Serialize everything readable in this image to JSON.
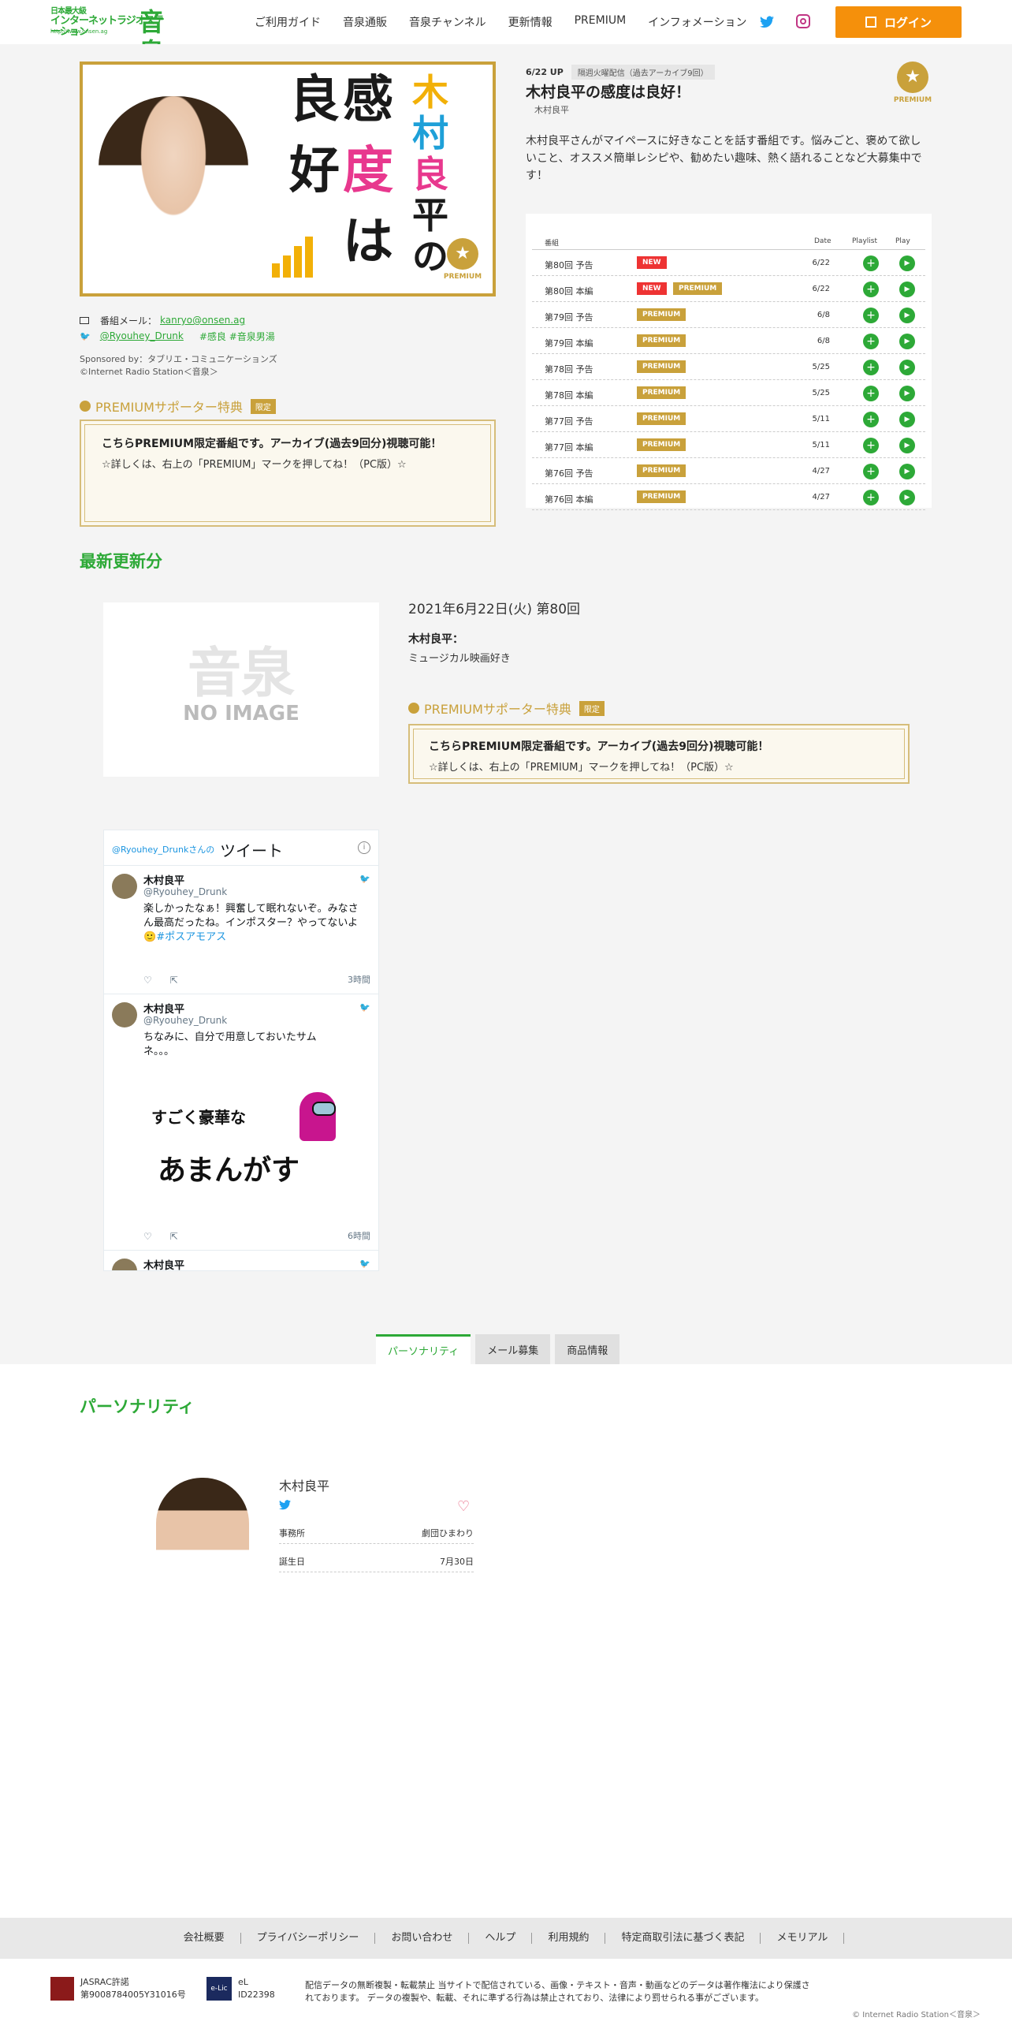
{
  "header": {
    "logo_line1": "日本最大級",
    "logo_line2": "インターネットラジオステーション",
    "logo_url": "http://www.onsen.ag",
    "logo_big": "音泉",
    "nav": [
      "ご利用ガイド",
      "音泉通販",
      "音泉チャンネル",
      "更新情報",
      "PREMIUM",
      "インフォメーション"
    ],
    "login": "ログイン"
  },
  "program": {
    "image_text": [
      "良",
      "好",
      "感",
      "度",
      "は",
      "木",
      "村",
      "良",
      "平",
      "の"
    ],
    "premium_label": "PREMIUM",
    "mail_label": "番組メール：",
    "mail": "kanryo@onsen.ag",
    "twitter": "@Ryouhey_Drunk",
    "hashtags": "#感良 #音泉男湯",
    "sponsor": "Sponsored by：タブリエ・コミュニケーションズ",
    "copyright": "©Internet Radio Station＜音泉＞",
    "premium_head": "PREMIUMサポーター特典",
    "premium_tag": "限定",
    "premium_bold": "こちらPREMIUM限定番組です。アーカイブ(過去9回分)視聴可能！",
    "premium_sub": "☆詳しくは、右上の「PREMIUM」マークを押してね！（PC版）☆",
    "up_date": "6/22 UP",
    "up_tag": "隔週火曜配信（過去アーカイブ9回）",
    "title": "木村良平の感度は良好！",
    "person": "木村良平",
    "description": "木村良平さんがマイペースに好きなことを話す番組です。悩みごと、褒めて欲しいこと、オススメ簡単レシピや、勧めたい趣味、熱く語れることなど大募集中です！"
  },
  "episode_table": {
    "headers": {
      "program": "番組",
      "date": "Date",
      "playlist": "Playlist",
      "play": "Play"
    },
    "rows": [
      {
        "title": "第80回 予告",
        "new": "NEW",
        "premium": "",
        "date": "6/22"
      },
      {
        "title": "第80回 本編",
        "new": "NEW",
        "premium": "PREMIUM",
        "date": "6/22"
      },
      {
        "title": "第79回 予告",
        "new": "",
        "premium": "PREMIUM",
        "date": "6/8"
      },
      {
        "title": "第79回 本編",
        "new": "",
        "premium": "PREMIUM",
        "date": "6/8"
      },
      {
        "title": "第78回 予告",
        "new": "",
        "premium": "PREMIUM",
        "date": "5/25"
      },
      {
        "title": "第78回 本編",
        "new": "",
        "premium": "PREMIUM",
        "date": "5/25"
      },
      {
        "title": "第77回 予告",
        "new": "",
        "premium": "PREMIUM",
        "date": "5/11"
      },
      {
        "title": "第77回 本編",
        "new": "",
        "premium": "PREMIUM",
        "date": "5/11"
      },
      {
        "title": "第76回 予告",
        "new": "",
        "premium": "PREMIUM",
        "date": "4/27"
      },
      {
        "title": "第76回 本編",
        "new": "",
        "premium": "PREMIUM",
        "date": "4/27"
      }
    ]
  },
  "latest": {
    "title": "最新更新分",
    "noimage_big": "音泉",
    "noimage": "NO IMAGE",
    "date": "2021年6月22日(火) 第80回",
    "person": "木村良平：",
    "note": "ミュージカル映画好き",
    "premium_head": "PREMIUMサポーター特典",
    "premium_tag": "限定",
    "premium_bold": "こちらPREMIUM限定番組です。アーカイブ(過去9回分)視聴可能！",
    "premium_sub": "☆詳しくは、右上の「PREMIUM」マークを押してね！（PC版）☆"
  },
  "twitter_widget": {
    "head_handle": "@Ryouhey_Drunkさんの",
    "head_title": "ツイート",
    "info": "i",
    "tweets": [
      {
        "name": "木村良平",
        "handle": "@Ryouhey_Drunk",
        "text": "楽しかったなぁ！興奮して眠れないぞ。みなさん最高だったね。インポスター？やってないよ🙂",
        "hashtag": "#ポスアモアス",
        "time": "3時間"
      },
      {
        "name": "木村良平",
        "handle": "@Ryouhey_Drunk",
        "text": "ちなみに、自分で用意しておいたサムネ。。。",
        "hashtag": "",
        "time": "6時間",
        "img_line1": "すごく豪華な",
        "img_line2": "あまんがす"
      },
      {
        "name": "木村良平"
      }
    ]
  },
  "tabs": [
    "パーソナリティ",
    "メール募集",
    "商品情報"
  ],
  "personality": {
    "section_title": "パーソナリティ",
    "name": "木村良平",
    "rows": [
      {
        "k": "事務所",
        "v": "劇団ひまわり"
      },
      {
        "k": "誕生日",
        "v": "7月30日"
      }
    ]
  },
  "footer": {
    "links": [
      "会社概要",
      "プライバシーポリシー",
      "お問い合わせ",
      "ヘルプ",
      "利用規約",
      "特定商取引法に基づく表記",
      "メモリアル"
    ],
    "jasrac_line1": "JASRAC許諾",
    "jasrac_line2": "第9008784005Y31016号",
    "elic_logo": "e-Lic",
    "elic_line1": "eL",
    "elic_line2": "ID22398",
    "notice": "配信データの無断複製・転載禁止 当サイトで配信されている、画像・テキスト・音声・動画などのデータは著作権法により保護されております。 データの複製や、転載、それに準ずる行為は禁止されており、法律により罰せられる事がございます。",
    "copyright": "© Internet Radio Station＜音泉＞"
  },
  "colors": {
    "brand_green": "#2da937",
    "login_orange": "#f5900b",
    "premium_gold": "#c9a13b",
    "new_red": "#e33333"
  }
}
